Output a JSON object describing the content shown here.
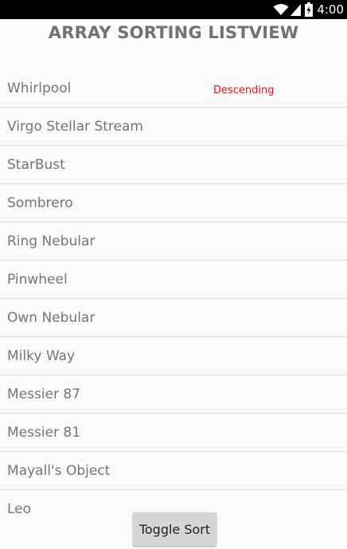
{
  "status_bar": {
    "time": "4:00",
    "icons": [
      "wifi-icon",
      "cellular-signal-icon",
      "battery-charging-icon"
    ]
  },
  "app": {
    "title": "ARRAY SORTING LISTVIEW",
    "sort_order_label": "Descending",
    "accent_color": "#e8141b"
  },
  "list": {
    "items": [
      {
        "label": "Whirlpool"
      },
      {
        "label": "Virgo Stellar Stream"
      },
      {
        "label": "StarBust"
      },
      {
        "label": "Sombrero"
      },
      {
        "label": "Ring Nebular"
      },
      {
        "label": "Pinwheel"
      },
      {
        "label": "Own Nebular"
      },
      {
        "label": "Milky Way"
      },
      {
        "label": "Messier 87"
      },
      {
        "label": "Messier 81"
      },
      {
        "label": "Mayall's Object"
      },
      {
        "label": "Leo"
      }
    ]
  },
  "actions": {
    "toggle_label": "Toggle Sort"
  }
}
